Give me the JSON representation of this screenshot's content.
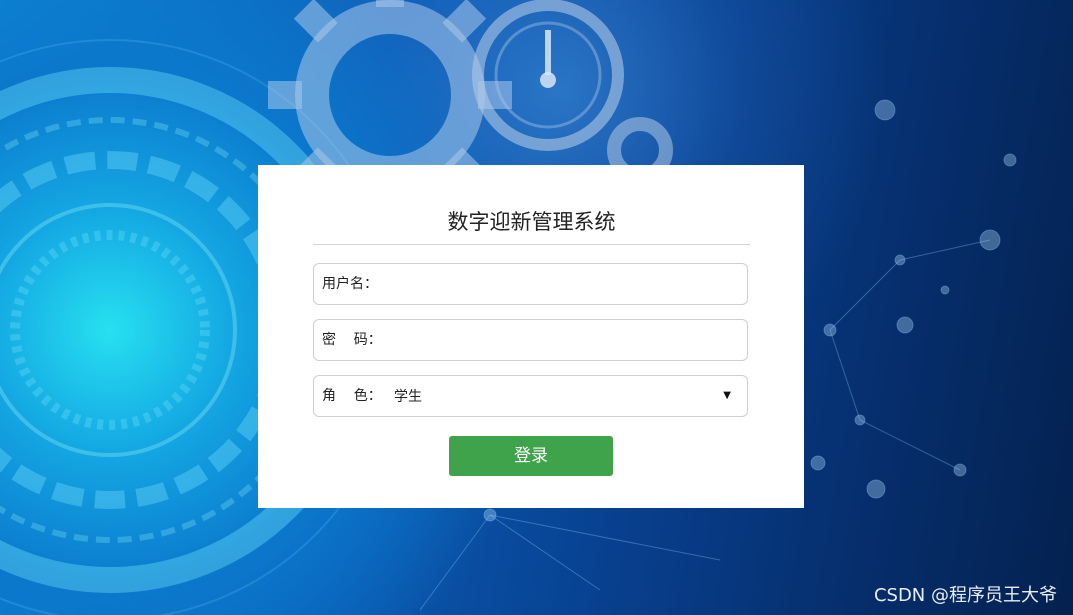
{
  "login": {
    "title": "数字迎新管理系统",
    "username_label": "用户名：",
    "username_value": "",
    "password_label": "密    码：",
    "password_value": "",
    "role_label": "角    色：",
    "role_value": "学生",
    "submit_label": "登录"
  },
  "watermark": "CSDN @程序员王大爷",
  "background": {
    "icons": [
      "circuit-ring",
      "gear-icon",
      "stopwatch-icon",
      "network-nodes"
    ]
  },
  "colors": {
    "button": "#3ea34a",
    "card": "#ffffff",
    "background_dark": "#04214f",
    "background_light": "#27e0f0"
  }
}
